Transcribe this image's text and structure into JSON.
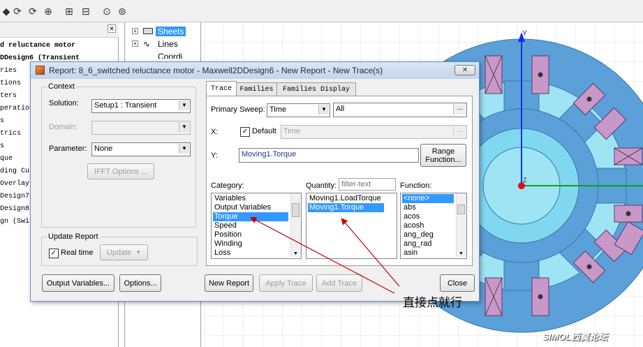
{
  "toolbar": {
    "icons": [
      "cursor-icon",
      "refresh-icon",
      "refresh-icon",
      "refresh-icon",
      "zoom-area-icon",
      "zoom-in-icon",
      "zoom-out-icon",
      "fit-all-icon",
      "fit-selection-icon"
    ]
  },
  "project_tree": {
    "items": [
      "d reluctance motor",
      "DDesign6 (Transient",
      "ries",
      "tions",
      "ters",
      "peration",
      "s",
      "trics",
      "s",
      "que",
      "ding Cu",
      "Overlay",
      "Design7",
      "Design8",
      "gn (Swi"
    ]
  },
  "sheet_tree": {
    "items": [
      {
        "label": "Sheets",
        "selected": true
      },
      {
        "label": "Lines",
        "selected": false
      },
      {
        "label": "Coordi",
        "selected": false
      }
    ]
  },
  "colors": {
    "rotor": "#7fd8f0",
    "stator": "#5ba0d8",
    "coil": "#c898c8",
    "axis_y": "#1030e0",
    "axis_x": "#10a010",
    "origin": "#e01010",
    "annotation": "#cc0000",
    "selection": "#3399ff"
  },
  "canvas": {
    "axis_y_label": "Y",
    "axis_z_label": "Z",
    "watermark": "SIMOL西莫论坛"
  },
  "dialog": {
    "title": "Report: 8_6_switched reluctance motor - Maxwell2DDesign6 - New Report - New Trace(s)",
    "close_label": "✕",
    "context": {
      "group_label": "Context",
      "solution_label": "Solution:",
      "solution_value": "Setup1 : Transient",
      "domain_label": "Domain:",
      "domain_value": "",
      "parameter_label": "Parameter:",
      "parameter_value": "None",
      "ifft_button": "IFFT Options ..."
    },
    "update_report": {
      "group_label": "Update Report",
      "realtime_label": "Real time",
      "realtime_checked": true,
      "update_button": "Update"
    },
    "bottom_buttons": {
      "output_variables": "Output Variables...",
      "options": "Options...",
      "new_report": "New Report",
      "apply_trace": "Apply Trace",
      "add_trace": "Add Trace",
      "close": "Close"
    },
    "tabs": [
      "Trace",
      "Families",
      "Families Display"
    ],
    "trace": {
      "primary_sweep_label": "Primary Sweep:",
      "primary_sweep_value": "Time",
      "primary_sweep_range": "All",
      "ellipsis": "...",
      "x_label": "X:",
      "default_label": "Default",
      "default_checked": true,
      "x_value": "Time",
      "y_label": "Y:",
      "y_value": "Moving1.Torque",
      "range_function_button": "Range\nFunction...",
      "category_label": "Category:",
      "quantity_label": "Quantity:",
      "quantity_filter_placeholder": "filter-text",
      "function_label": "Function:",
      "categories": [
        "Variables",
        "Output Variables",
        "Torque",
        "Speed",
        "Position",
        "Winding",
        "Loss"
      ],
      "category_selected": 2,
      "quantities": [
        "Moving1.LoadTorque",
        "Moving1.Torque"
      ],
      "quantity_selected": 1,
      "functions": [
        "<none>",
        "abs",
        "acos",
        "acosh",
        "ang_deg",
        "ang_rad",
        "asin"
      ],
      "function_selected": 0
    }
  },
  "annotation": {
    "text": "直接点就行"
  }
}
